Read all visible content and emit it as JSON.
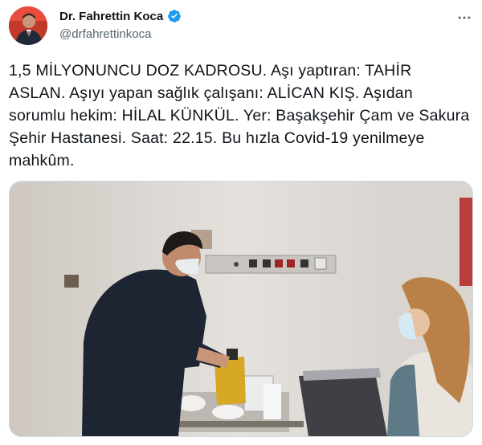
{
  "author": {
    "display_name": "Dr. Fahrettin Koca",
    "handle": "@drfahrettinkoca",
    "verified": true,
    "avatar_icon": "profile-photo"
  },
  "menu_icon": "more-horizontal-icon",
  "tweet_text": "1,5 MİLYONUNCU DOZ KADROSU. Aşı yaptıran: TAHİR ASLAN. Aşıyı yapan sağlık çalışanı: ALİCAN KIŞ. Aşıdan sorumlu hekim: HİLAL KÜNKÜL. Yer: Başakşehir Çam ve Sakura Şehir Hastanesi. Saat: 22.15. Bu hızla Covid-19 yenilmeye mahkûm.",
  "colors": {
    "verified_blue": "#1d9bf0",
    "text_primary": "#0f1419",
    "text_secondary": "#536471"
  }
}
